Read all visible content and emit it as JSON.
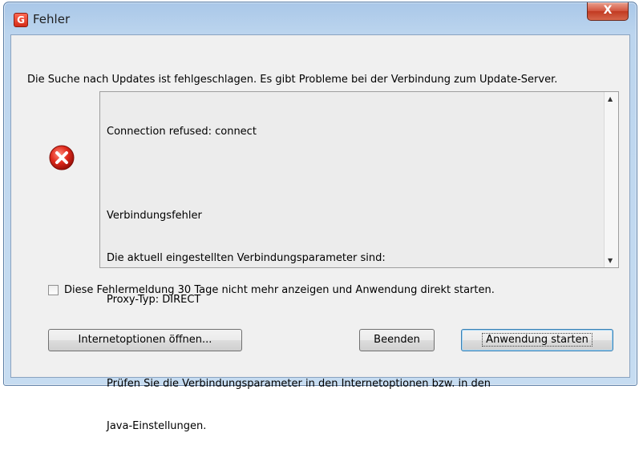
{
  "window": {
    "title": "Fehler",
    "icon": "app-g-icon",
    "close_label": "X"
  },
  "message": "Die Suche nach Updates ist fehlgeschlagen. Es gibt Probleme bei der Verbindung zum Update-Server.",
  "error_icon": "error-x-icon",
  "details": {
    "lines": [
      "Connection refused: connect",
      "",
      "Verbindungsfehler",
      "Die aktuell eingestellten Verbindungsparameter sind:",
      "Proxy-Typ: DIRECT",
      "",
      "Prüfen Sie die Verbindungsparameter in den Internetoptionen bzw. in den",
      "Java-Einstellungen."
    ]
  },
  "checkbox": {
    "label": "Diese Fehlermeldung 30 Tage nicht mehr anzeigen und Anwendung direkt starten.",
    "checked": false
  },
  "buttons": {
    "internet_options": "Internetoptionen öffnen...",
    "quit": "Beenden",
    "start_app": "Anwendung starten"
  },
  "colors": {
    "titlebar": "#bcd5ee",
    "close_button": "#c13a22",
    "error_icon": "#d11f1f",
    "default_button_border": "#3c7fb1"
  }
}
